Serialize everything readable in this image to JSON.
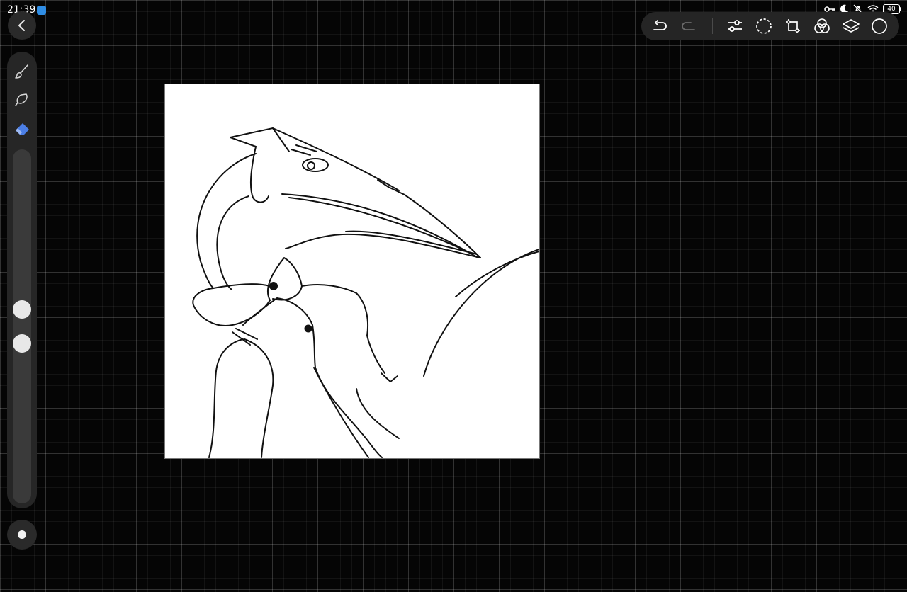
{
  "status_bar": {
    "time": "21:39",
    "battery_level": "40",
    "icons": [
      "key-icon",
      "moon-icon",
      "mute-icon",
      "wifi-icon",
      "battery-icon"
    ]
  },
  "toolbar": {
    "buttons": [
      "undo-icon",
      "redo-icon",
      "adjustments-icon",
      "selection-icon",
      "transform-icon",
      "blend-icon",
      "layers-icon",
      "color-icon"
    ]
  },
  "sidebar": {
    "tools": [
      "brush-icon",
      "smudge-icon",
      "eraser-icon"
    ],
    "active_tool": "eraser",
    "brush_size_fraction": 0.55,
    "opacity_fraction": 0.45
  },
  "colors": {
    "background": "#050505",
    "panel": "#262626",
    "accent": "#4c7fe6",
    "current_color": "#f2f2f2",
    "canvas": "#ffffff"
  }
}
